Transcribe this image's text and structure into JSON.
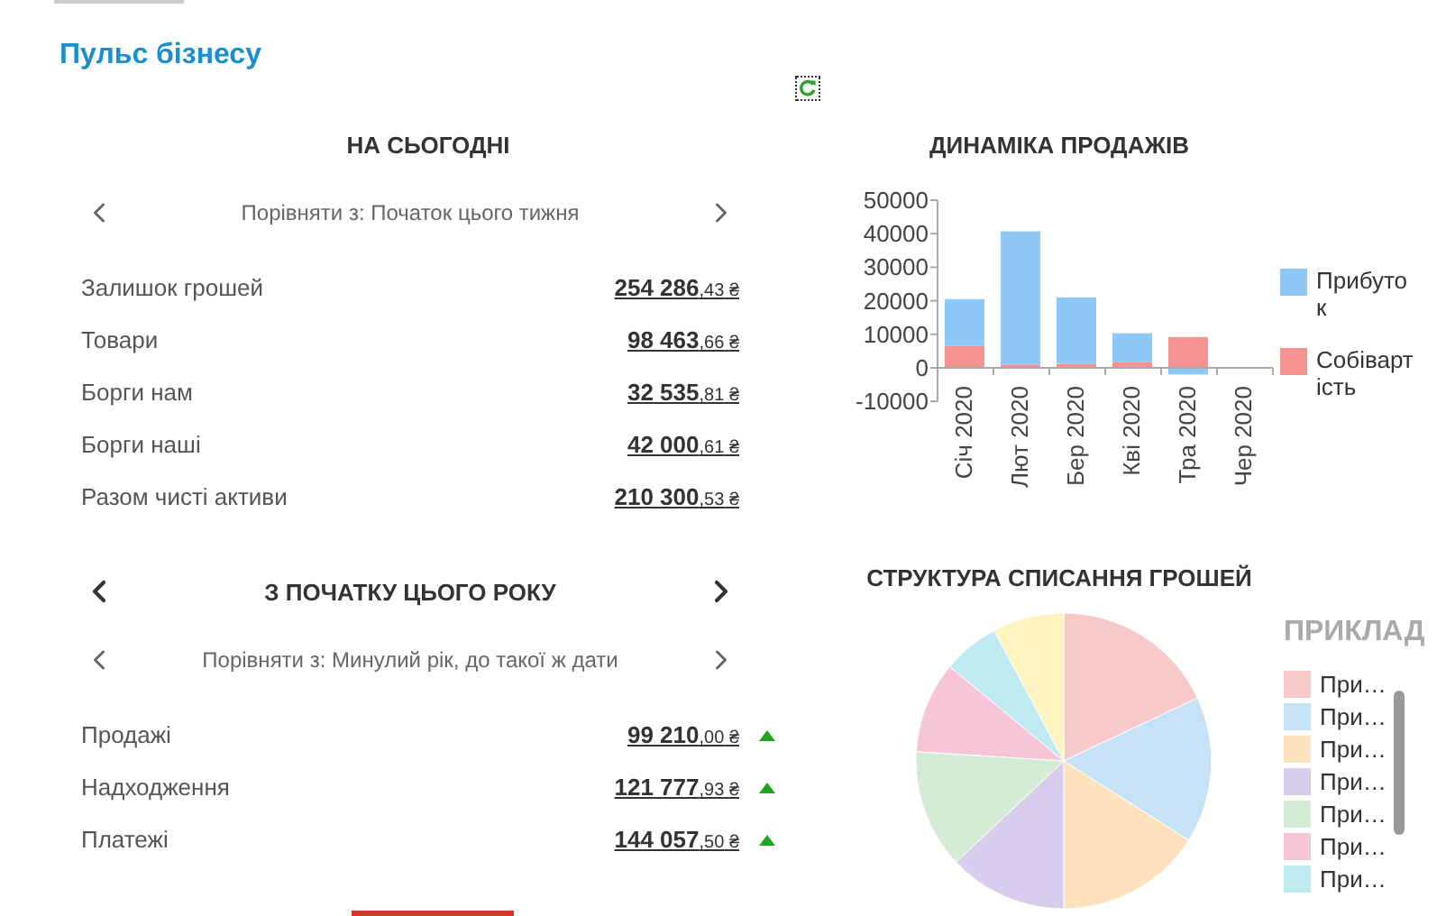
{
  "title": "Пульс бізнесу",
  "today": {
    "heading": "НА СЬОГОДНІ",
    "compare": "Порівняти з: Початок цього тижня",
    "rows": [
      {
        "label": "Залишок грошей",
        "amount": "254 286",
        "cents": ",43",
        "currency": "₴"
      },
      {
        "label": "Товари",
        "amount": "98 463",
        "cents": ",66",
        "currency": "₴"
      },
      {
        "label": "Борги нам",
        "amount": "32 535",
        "cents": ",81",
        "currency": "₴"
      },
      {
        "label": "Борги наші",
        "amount": "42 000",
        "cents": ",61",
        "currency": "₴"
      },
      {
        "label": "Разом чисті активи",
        "amount": "210 300",
        "cents": ",53",
        "currency": "₴"
      }
    ]
  },
  "year": {
    "heading": "З ПОЧАТКУ ЦЬОГО РОКУ",
    "compare": "Порівняти з: Минулий рік, до такої ж дати",
    "rows": [
      {
        "label": "Продажі",
        "amount": "99 210",
        "cents": ",00",
        "currency": "₴",
        "rising": true
      },
      {
        "label": "Надходження",
        "amount": "121 777",
        "cents": ",93",
        "currency": "₴",
        "rising": true
      },
      {
        "label": "Платежі",
        "amount": "144 057",
        "cents": ",50",
        "currency": "₴",
        "rising": true
      }
    ]
  },
  "sales_chart": {
    "title": "ДИНАМІКА ПРОДАЖІВ",
    "chart_data": {
      "type": "bar",
      "stacked": true,
      "categories": [
        "Січ 2020",
        "Лют 2020",
        "Бер 2020",
        "Кві 2020",
        "Тра 2020",
        "Чер 2020"
      ],
      "ylim": [
        -10000,
        50000
      ],
      "yticks": [
        -10000,
        0,
        10000,
        20000,
        30000,
        40000,
        50000
      ],
      "series": [
        {
          "name": "Прибуток",
          "color": "#8ec8f6",
          "values": [
            14000,
            39700,
            19800,
            8500,
            -2000,
            0
          ]
        },
        {
          "name": "Собівартість",
          "color": "#f4938f",
          "values": [
            6500,
            1000,
            1200,
            1800,
            9200,
            0
          ]
        }
      ]
    }
  },
  "expense_chart": {
    "title": "СТРУКТУРА СПИСАННЯ ГРОШЕЙ",
    "legend_title": "ПРИКЛАД",
    "legend": [
      {
        "label": "При…",
        "color": "#f7c9c9"
      },
      {
        "label": "При…",
        "color": "#c6e2f9"
      },
      {
        "label": "При…",
        "color": "#fde2bd"
      },
      {
        "label": "При…",
        "color": "#d8cdec"
      },
      {
        "label": "При…",
        "color": "#d4ebd4"
      },
      {
        "label": "При…",
        "color": "#f6c6d8"
      },
      {
        "label": "При…",
        "color": "#bfeaf1"
      }
    ]
  }
}
